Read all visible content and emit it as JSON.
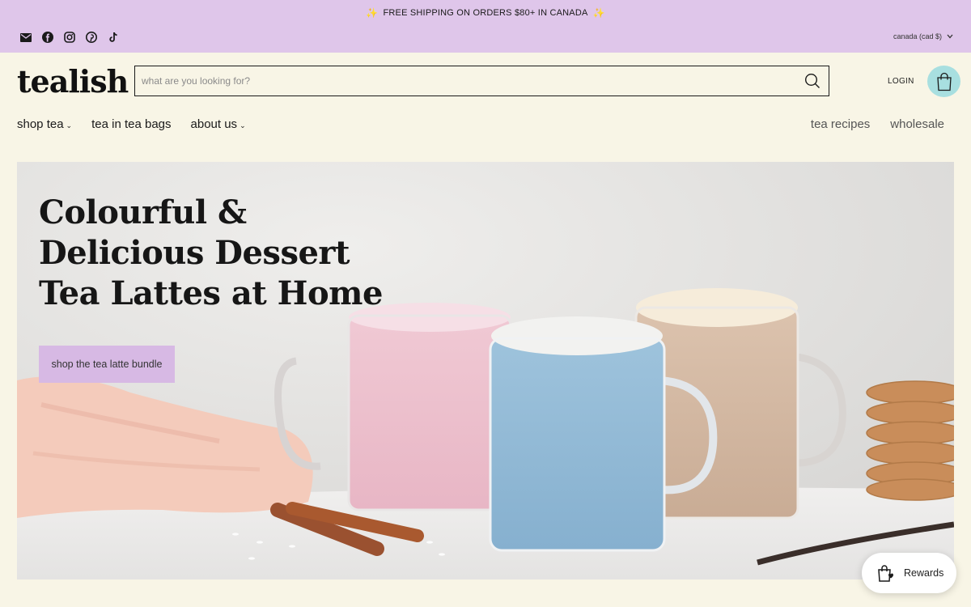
{
  "announcement": {
    "text": "FREE SHIPPING ON ORDERS $80+ IN CANADA",
    "spark_glyph": "✨"
  },
  "socials": [
    "email-icon",
    "facebook-icon",
    "instagram-icon",
    "pinterest-icon",
    "tiktok-icon"
  ],
  "currency": {
    "label": "canada (cad $)"
  },
  "header": {
    "logo": "tealish",
    "search_placeholder": "what are you looking for?",
    "login_label": "LOGIN",
    "cart_icon": "shopping-bag-icon"
  },
  "nav": {
    "left": [
      {
        "label": "shop tea",
        "has_dropdown": true
      },
      {
        "label": "tea in tea bags",
        "has_dropdown": false
      },
      {
        "label": "about us",
        "has_dropdown": true
      }
    ],
    "right": [
      {
        "label": "tea recipes"
      },
      {
        "label": "wholesale"
      }
    ]
  },
  "hero": {
    "title": "Colourful & Delicious Dessert Tea Lattes at Home",
    "button_label": "shop the tea latte bundle"
  },
  "rewards": {
    "label": "Rewards"
  },
  "colors": {
    "topbar": "#dfc6ea",
    "page_bg": "#f8f5e6",
    "cart_bg": "#a8dfe0",
    "hero_button": "#d7b9e4"
  }
}
